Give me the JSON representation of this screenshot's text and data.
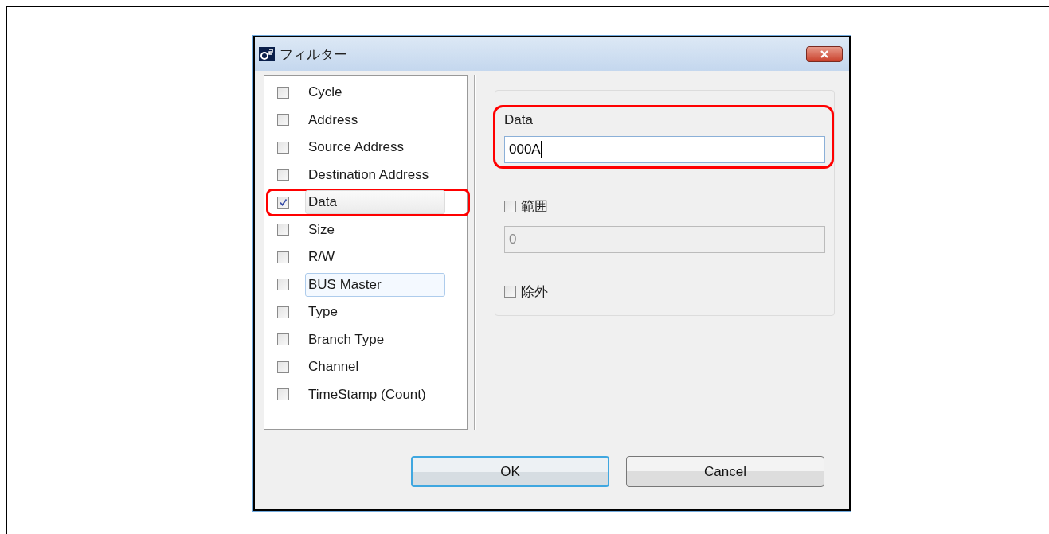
{
  "window": {
    "title": "フィルター"
  },
  "columns": [
    {
      "label": "Cycle",
      "checked": false,
      "selected": false,
      "hovered": false,
      "highlighted": false
    },
    {
      "label": "Address",
      "checked": false,
      "selected": false,
      "hovered": false,
      "highlighted": false
    },
    {
      "label": "Source Address",
      "checked": false,
      "selected": false,
      "hovered": false,
      "highlighted": false
    },
    {
      "label": "Destination Address",
      "checked": false,
      "selected": false,
      "hovered": false,
      "highlighted": false
    },
    {
      "label": "Data",
      "checked": true,
      "selected": true,
      "hovered": false,
      "highlighted": true
    },
    {
      "label": "Size",
      "checked": false,
      "selected": false,
      "hovered": false,
      "highlighted": false
    },
    {
      "label": "R/W",
      "checked": false,
      "selected": false,
      "hovered": false,
      "highlighted": false
    },
    {
      "label": "BUS Master",
      "checked": false,
      "selected": false,
      "hovered": true,
      "highlighted": false
    },
    {
      "label": "Type",
      "checked": false,
      "selected": false,
      "hovered": false,
      "highlighted": false
    },
    {
      "label": "Branch Type",
      "checked": false,
      "selected": false,
      "hovered": false,
      "highlighted": false
    },
    {
      "label": "Channel",
      "checked": false,
      "selected": false,
      "hovered": false,
      "highlighted": false
    },
    {
      "label": "TimeStamp (Count)",
      "checked": false,
      "selected": false,
      "hovered": false,
      "highlighted": false
    }
  ],
  "detail": {
    "label": "Data",
    "value": "000A",
    "highlighted": true,
    "range": {
      "label": "範囲",
      "checked": false
    },
    "range_field": {
      "value": "0",
      "disabled": true
    },
    "exclude": {
      "label": "除外",
      "checked": false
    }
  },
  "buttons": [
    {
      "label": "OK",
      "default": true
    },
    {
      "label": "Cancel",
      "default": false
    }
  ]
}
